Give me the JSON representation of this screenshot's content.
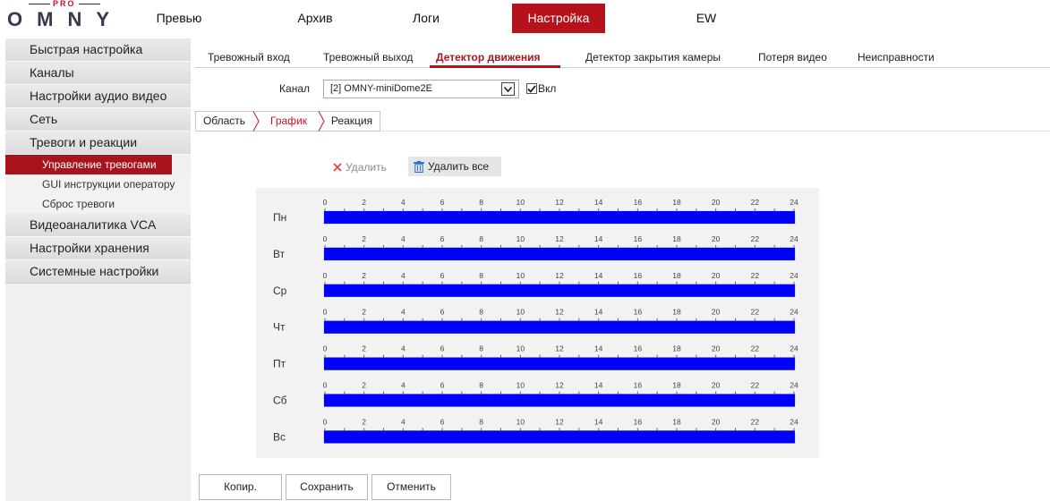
{
  "logo": {
    "tag": "PRO",
    "brand": "OMNY"
  },
  "nav": {
    "items": [
      {
        "label": "Превью",
        "active": false
      },
      {
        "label": "Архив",
        "active": false
      },
      {
        "label": "Логи",
        "active": false
      },
      {
        "label": "Настройка",
        "active": true
      },
      {
        "label": "EW",
        "active": false
      }
    ]
  },
  "sidebar": {
    "items": [
      {
        "label": "Быстрая настройка"
      },
      {
        "label": "Каналы"
      },
      {
        "label": "Настройки аудио видео"
      },
      {
        "label": "Сеть"
      },
      {
        "label": "Тревоги и реакции",
        "expanded": true,
        "children": [
          {
            "label": "Управление тревогами",
            "active": true
          },
          {
            "label": "GUI инструкции оператору",
            "active": false
          },
          {
            "label": "Сброс тревоги",
            "active": false
          }
        ]
      },
      {
        "label": "Видеоаналитика VCA"
      },
      {
        "label": "Настройки хранения"
      },
      {
        "label": "Системные настройки"
      }
    ]
  },
  "tabs": [
    {
      "label": "Тревожный вход",
      "active": false
    },
    {
      "label": "Тревожный выход",
      "active": false
    },
    {
      "label": "Детектор движения",
      "active": true
    },
    {
      "label": "Детектор закрытия камеры",
      "active": false
    },
    {
      "label": "Потеря видео",
      "active": false
    },
    {
      "label": "Неисправности",
      "active": false
    }
  ],
  "channel": {
    "label": "Канал",
    "selected": "[2] OMNY-miniDome2E",
    "enabled": true,
    "enable_label": "Вкл"
  },
  "subtabs": [
    {
      "label": "Область",
      "active": false
    },
    {
      "label": "График",
      "active": true
    },
    {
      "label": "Реакция",
      "active": false
    }
  ],
  "schedule_actions": {
    "delete_label": "Удалить",
    "delete_enabled": false,
    "delete_all_label": "Удалить все"
  },
  "schedule": {
    "hour_ticks": [
      0,
      2,
      4,
      6,
      8,
      10,
      12,
      14,
      16,
      18,
      20,
      22,
      24
    ],
    "days": [
      {
        "label": "Пн",
        "segments": [
          [
            0,
            24
          ]
        ]
      },
      {
        "label": "Вт",
        "segments": [
          [
            0,
            24
          ]
        ]
      },
      {
        "label": "Ср",
        "segments": [
          [
            0,
            24
          ]
        ]
      },
      {
        "label": "Чт",
        "segments": [
          [
            0,
            24
          ]
        ]
      },
      {
        "label": "Пт",
        "segments": [
          [
            0,
            24
          ]
        ]
      },
      {
        "label": "Сб",
        "segments": [
          [
            0,
            24
          ]
        ]
      },
      {
        "label": "Вс",
        "segments": [
          [
            0,
            24
          ]
        ]
      }
    ]
  },
  "buttons": {
    "copy": "Копир.",
    "save": "Сохранить",
    "cancel": "Отменить"
  },
  "colors": {
    "accent": "#b5121b",
    "schedule_fill": "#0000ff",
    "trash_icon": "#1e6fd0",
    "delete_icon": "#e53935"
  },
  "icons": {
    "delete": "close-icon",
    "delete_all": "trash-icon",
    "select_arrow": "chevron-down-icon",
    "enable_check": "checkmark-icon"
  }
}
